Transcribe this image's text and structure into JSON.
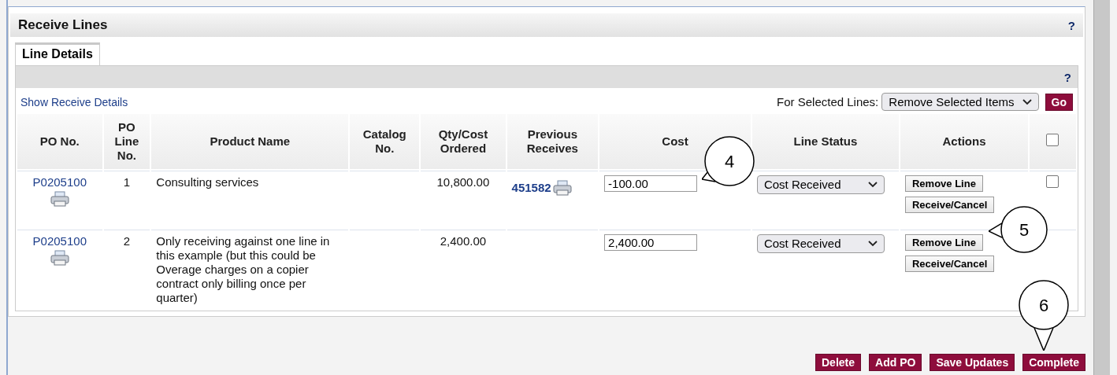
{
  "panel": {
    "title": "Receive Lines",
    "help": "?"
  },
  "tabs": [
    {
      "label": "Line Details",
      "selected": true
    }
  ],
  "subbar": {
    "help": "?"
  },
  "toolbar": {
    "link": "Show Receive Details",
    "bulk_label": "For Selected Lines:",
    "bulk_value": "Remove Selected Items",
    "go": "Go"
  },
  "table": {
    "columns": [
      "PO No.",
      "PO Line No.",
      "Product Name",
      "Catalog No.",
      "Qty/Cost Ordered",
      "Previous Receives",
      "Cost",
      "Line Status",
      "Actions"
    ],
    "select_all_checked": false,
    "rows": [
      {
        "po": "P0205100",
        "line": "1",
        "product": "Consulting services",
        "ordered": "10,800.00",
        "previous": "451582",
        "cost": "-100.00",
        "status": "Cost Received",
        "actions": [
          "Remove Line",
          "Receive/Cancel"
        ],
        "checked": false
      },
      {
        "po": "P0205100",
        "line": "2",
        "product": "Only receiving against one line in this example (but this could be Overage charges on a copier contract only billing once per quarter)",
        "ordered": "2,400.00",
        "cost": "2,400.00",
        "status": "Cost Received",
        "actions": [
          "Remove Line",
          "Receive/Cancel"
        ]
      }
    ]
  },
  "buttons": [
    "Delete",
    "Add PO",
    "Save Updates",
    "Complete"
  ],
  "callouts": [
    {
      "label": "4"
    },
    {
      "label": "5"
    },
    {
      "label": "6"
    }
  ]
}
